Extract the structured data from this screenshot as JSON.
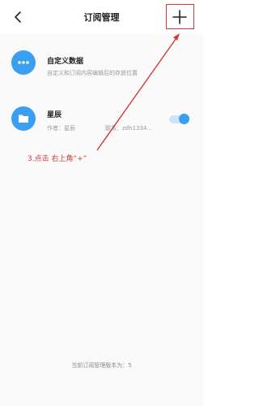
{
  "header": {
    "title": "订阅管理",
    "back_icon": "chevron-left-icon",
    "add_icon": "plus-icon"
  },
  "items": [
    {
      "title": "自定义数据",
      "subtitle": "自定义和订阅内容编辑后的存放位置",
      "icon": "more-dots-icon"
    },
    {
      "title": "星辰",
      "author": "作者：星辰",
      "contact": "联系：zdh1334...",
      "icon": "folder-icon",
      "toggle_on": true
    }
  ],
  "annotation": "3.点击 右上角“+”",
  "footer": "当前订阅管理版本为：5",
  "colors": {
    "accent": "#3a9ff1",
    "annotation": "#d33a35"
  }
}
